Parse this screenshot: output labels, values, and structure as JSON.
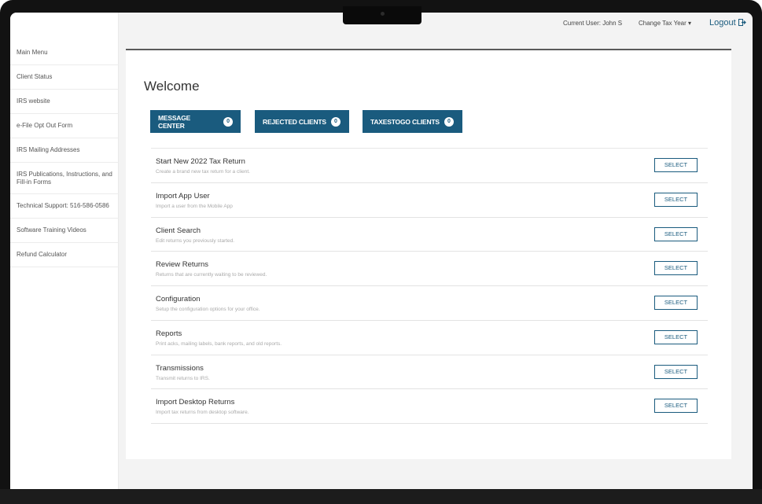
{
  "header": {
    "current_user": "Current User: John S",
    "change_tax_year": "Change Tax Year ▾",
    "logout": "Logout"
  },
  "sidebar": {
    "items": [
      {
        "label": "Main Menu"
      },
      {
        "label": "Client Status"
      },
      {
        "label": "IRS website"
      },
      {
        "label": "e-File Opt Out Form"
      },
      {
        "label": "IRS Mailing Addresses"
      },
      {
        "label": "IRS Publications, Instructions, and Fill-in Forms"
      },
      {
        "label": "Technical Support: 516-586-0586"
      },
      {
        "label": "Software Training Videos"
      },
      {
        "label": "Refund Calculator"
      }
    ]
  },
  "main": {
    "title": "Welcome",
    "pills": [
      {
        "label": "MESSAGE CENTER",
        "count": "0"
      },
      {
        "label": "REJECTED CLIENTS",
        "count": "0"
      },
      {
        "label": "TAXESTOGO CLIENTS",
        "count": "0"
      }
    ],
    "select_label": "SELECT",
    "rows": [
      {
        "title": "Start New 2022 Tax Return",
        "desc": "Create a brand new tax return for a client."
      },
      {
        "title": "Import App User",
        "desc": "Import a user from the Mobile App"
      },
      {
        "title": "Client Search",
        "desc": "Edit returns you previously started."
      },
      {
        "title": "Review Returns",
        "desc": "Returns that are currently waiting to be reviewed."
      },
      {
        "title": "Configuration",
        "desc": "Setup the configuration options for your office."
      },
      {
        "title": "Reports",
        "desc": "Print acks, mailing labels, bank reports, and old reports."
      },
      {
        "title": "Transmissions",
        "desc": "Transmit returns to IRS."
      },
      {
        "title": "Import Desktop Returns",
        "desc": "Import tax returns from desktop software."
      }
    ]
  },
  "colors": {
    "accent": "#1a5b7e",
    "bezel": "#121212",
    "screen_bg": "#f3f3f3"
  }
}
